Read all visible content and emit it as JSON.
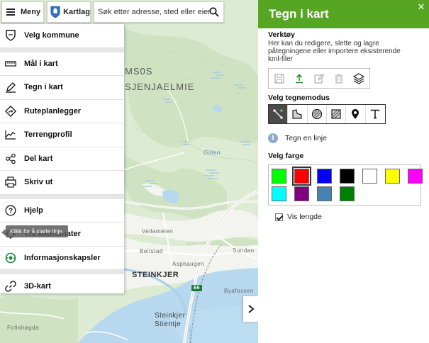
{
  "topbar": {
    "menu_label": "Meny",
    "layers_label": "Kartlag",
    "search_placeholder": "Søk etter adresse, sted eller eiendom"
  },
  "menu": {
    "items": [
      {
        "label": "Velg kommune",
        "icon": "shield-icon"
      },
      {
        "label": "Mål i kart",
        "icon": "ruler-icon"
      },
      {
        "label": "Tegn i kart",
        "icon": "pencil-icon"
      },
      {
        "label": "Ruteplanlegger",
        "icon": "route-sign-icon"
      },
      {
        "label": "Terrengprofil",
        "icon": "terrain-profile-icon"
      },
      {
        "label": "Del kart",
        "icon": "share-icon"
      },
      {
        "label": "Skriv ut",
        "icon": "printer-icon"
      },
      {
        "label": "Hjelp",
        "icon": "help-icon"
      },
      {
        "label": "Vis koordinater",
        "icon": "crosshair-icon"
      },
      {
        "label": "Informasjonskapsler",
        "icon": "cookie-icon"
      },
      {
        "label": "3D-kart",
        "icon": "link-icon"
      }
    ]
  },
  "tooltip": "Klikk for å starte linje.",
  "map": {
    "labels": {
      "msos": "MS0S",
      "sjaelmie": "SJENJAELMIE",
      "gilten": "Gilten",
      "vellameien": "Vellamelen",
      "beitstad": "Beitstad",
      "asphaugen": "Asphaugen",
      "steinkjer": "STEINKJER",
      "sundan": "Sundan",
      "byafossen": "Byafossen",
      "steinkjer_stientje": "Steinkjer\nStientje",
      "follahogda": "Follahøgda",
      "e6": "E6"
    }
  },
  "panel": {
    "title": "Tegn i kart",
    "close_symbol": "✕",
    "tools_title": "Verktøy",
    "tools_desc": "Her kan du redigere, slette og lagre påtegningene eller importere eksisterende kml-filer",
    "tools": [
      "save-icon",
      "upload-icon",
      "edit-icon",
      "trash-icon",
      "layers-icon"
    ],
    "draw_mode_title": "Velg tegnemodus",
    "modes": [
      "line-mode-icon",
      "polygon-mode-icon",
      "circle-mode-icon",
      "rectangle-mode-icon",
      "marker-mode-icon",
      "text-mode-icon"
    ],
    "active_mode_index": 0,
    "mode_info": "Tegn en linje",
    "color_title": "Velg farge",
    "colors": [
      "#00ff00",
      "#ff0000",
      "#0000ff",
      "#000000",
      "#ffffff",
      "#ffff00",
      "#ff00ff",
      "#00ffff",
      "#800080",
      "#4682b4",
      "#008000"
    ],
    "selected_color_index": 1,
    "show_length_label": "Vis lengde",
    "show_length_checked": true
  }
}
